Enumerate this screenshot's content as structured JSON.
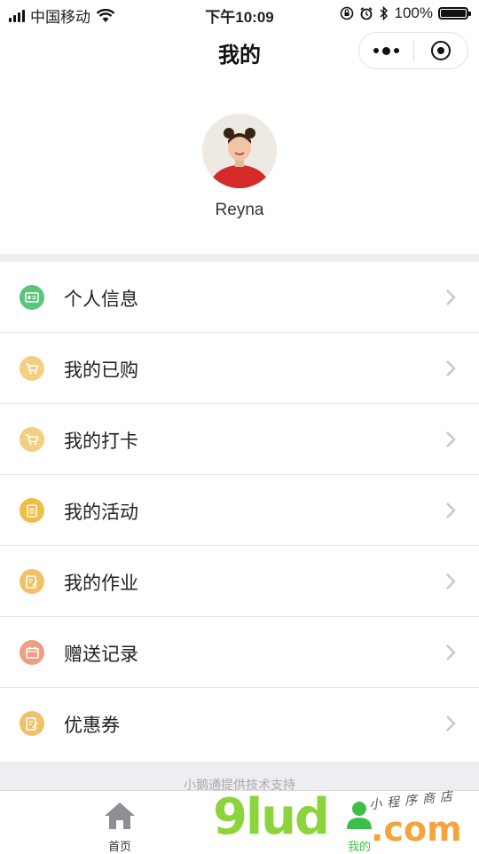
{
  "status_bar": {
    "carrier": "中国移动",
    "time": "下午10:09",
    "battery": "100%"
  },
  "navbar": {
    "title": "我的"
  },
  "profile": {
    "username": "Reyna"
  },
  "menu": {
    "items": [
      {
        "label": "个人信息",
        "icon": "id-card-icon",
        "color": "#5bc57a"
      },
      {
        "label": "我的已购",
        "icon": "cart-icon",
        "color": "#f3cf82"
      },
      {
        "label": "我的打卡",
        "icon": "cart-icon",
        "color": "#f3cf82"
      },
      {
        "label": "我的活动",
        "icon": "document-icon",
        "color": "#f2bd45"
      },
      {
        "label": "我的作业",
        "icon": "notepad-icon",
        "color": "#f0c169"
      },
      {
        "label": "赠送记录",
        "icon": "calendar-icon",
        "color": "#ee9f82"
      },
      {
        "label": "优惠券",
        "icon": "notepad-icon",
        "color": "#f0c169"
      }
    ]
  },
  "footer": {
    "support_text": "小鹅通提供技术支持"
  },
  "tabbar": {
    "home_label": "首页",
    "mine_label": "我的"
  },
  "watermark": {
    "brand": "9lud",
    "domain": ".com",
    "tagline": "小程序商店"
  },
  "colors": {
    "active_tab": "#3fbf4a",
    "section_gap": "#ededf2"
  }
}
